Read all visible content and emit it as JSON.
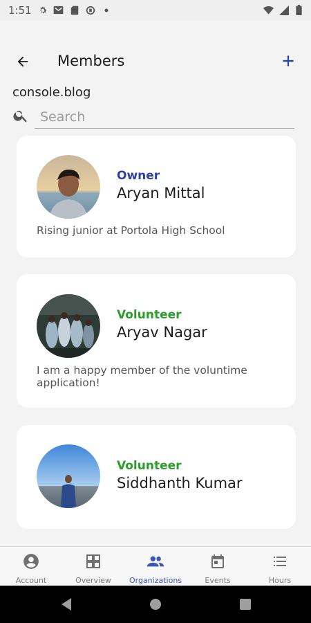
{
  "status_bar": {
    "time": "1:51"
  },
  "app_bar": {
    "title": "Members"
  },
  "organization": {
    "name": "console.blog"
  },
  "search": {
    "placeholder": "Search",
    "value": ""
  },
  "members": [
    {
      "role": "Owner",
      "name": "Aryan Mittal",
      "bio": "Rising junior at Portola High School",
      "role_color": "#2f3fa8"
    },
    {
      "role": "Volunteer",
      "name": "Aryav Nagar",
      "bio": "I am a happy member of the voluntime application!",
      "role_color": "#2a9d2a"
    },
    {
      "role": "Volunteer",
      "name": "Siddhanth Kumar",
      "bio": "",
      "role_color": "#2a9d2a"
    }
  ],
  "bottom_nav": {
    "items": [
      {
        "label": "Account",
        "icon": "account-icon"
      },
      {
        "label": "Overview",
        "icon": "overview-icon"
      },
      {
        "label": "Organizations",
        "icon": "organizations-icon"
      },
      {
        "label": "Events",
        "icon": "events-icon"
      },
      {
        "label": "Hours",
        "icon": "hours-icon"
      }
    ],
    "active": "Organizations"
  },
  "colors": {
    "accent": "#3c55b4",
    "owner": "#2f3fa8",
    "volunteer": "#2a9d2a"
  }
}
